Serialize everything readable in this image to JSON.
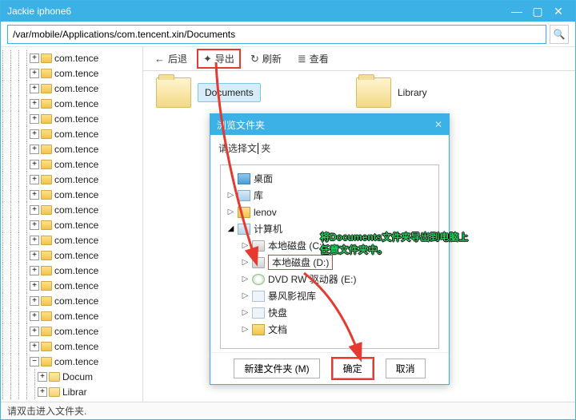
{
  "window": {
    "title": "Jackie iphone6",
    "minimize": "—",
    "maximize": "▢",
    "close": "✕"
  },
  "address": {
    "value": "/var/mobile/Applications/com.tencent.xin/Documents",
    "search_icon": "🔍"
  },
  "toolbar": {
    "back": {
      "icon": "←",
      "label": "后退"
    },
    "export": {
      "icon": "✦",
      "label": "导出"
    },
    "refresh": {
      "icon": "↻",
      "label": "刷新"
    },
    "view": {
      "icon": "≣",
      "label": "查看"
    }
  },
  "tree": {
    "items": [
      "com.tence",
      "com.tence",
      "com.tence",
      "com.tence",
      "com.tence",
      "com.tence",
      "com.tence",
      "com.tence",
      "com.tence",
      "com.tence",
      "com.tence",
      "com.tence",
      "com.tence",
      "com.tence",
      "com.tence",
      "com.tence",
      "com.tence",
      "com.tence",
      "com.tence",
      "com.tence",
      "com.tence"
    ],
    "expanded_children": [
      "Docum",
      "Librar"
    ]
  },
  "folders": {
    "documents": "Documents",
    "library": "Library"
  },
  "dialog": {
    "title": "浏览文件夹",
    "close": "✕",
    "prompt": "请选择文",
    "nodes": {
      "desktop": "桌面",
      "libraries": "库",
      "lenovo": "lenov",
      "computer": "计算机",
      "drive_c": "本地磁盘 (C:)",
      "drive_d": "本地磁盘 (D:)",
      "dvd": "DVD RW 驱动器 (E:)",
      "baofeng": "暴风影视库",
      "kuaipan": "快盘",
      "wendang": "文档"
    },
    "new_folder": "新建文件夹 (M)",
    "ok": "确定",
    "cancel": "取消"
  },
  "annotation": {
    "line1": "将Documents文件夹导出到电脑上",
    "line2": "任意文件夹中。"
  },
  "status": "请双击进入文件夹."
}
